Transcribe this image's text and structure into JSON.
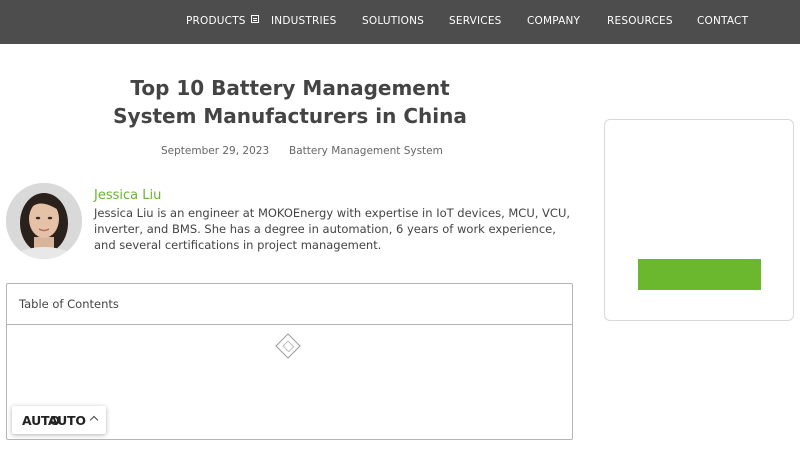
{
  "nav": {
    "items": [
      {
        "label": "PRODUCTS",
        "has_submenu_icon": true
      },
      {
        "label": "INDUSTRIES"
      },
      {
        "label": "SOLUTIONS"
      },
      {
        "label": "SERVICES"
      },
      {
        "label": "COMPANY"
      },
      {
        "label": "RESOURCES"
      },
      {
        "label": "CONTACT"
      }
    ]
  },
  "article": {
    "title_line1": "Top 10 Battery Management",
    "title_line2": "System Manufacturers in China",
    "date": "September 29, 2023",
    "category": "Battery Management System"
  },
  "author": {
    "name": "Jessica Liu",
    "bio": "Jessica Liu is an engineer at MOKOEnergy with expertise in IoT devices, MCU, VCU, inverter, and BMS. She has a degree in automation, 6 years of work experience, and several certifications in project management."
  },
  "toc": {
    "title": "Table of Contents",
    "image_icon": "broken-image-icon"
  },
  "sidebar": {
    "button_label": ""
  },
  "language": {
    "label_1": "AUTO",
    "label_2": "AUTO",
    "icon": "chevron-up-icon"
  },
  "colors": {
    "nav_bg": "#4d4d4d",
    "accent_green": "#6bb82f",
    "author_green": "#6ab42d",
    "text": "#444444"
  }
}
